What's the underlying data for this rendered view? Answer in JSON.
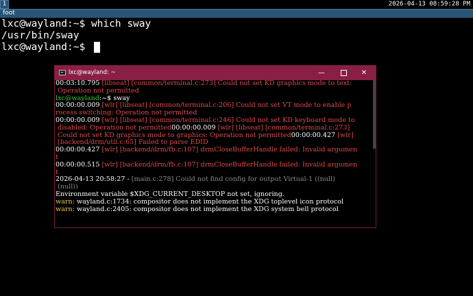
{
  "bar": {
    "workspace": "1",
    "clock": "2026-04-13 08:59:28 PM"
  },
  "window": {
    "title": "foot"
  },
  "foot": {
    "lines": [
      "lxc@wayland:~$ which sway",
      "/usr/bin/sway",
      "lxc@wayland:~$ "
    ]
  },
  "console": {
    "title": "lxc@wayland: ~",
    "buttons": {
      "minimize": "—",
      "close": "✕"
    },
    "lines": [
      {
        "parts": [
          {
            "c": "white",
            "t": "00:03:10.795 "
          },
          {
            "c": "red",
            "t": "[libseat] [common/terminal.c:273] Could not set KD graphics mode to text:"
          }
        ]
      },
      {
        "parts": [
          {
            "c": "red",
            "t": " Operation not permitted"
          }
        ]
      },
      {
        "parts": [
          {
            "c": "grn",
            "t": "lxc@wayland"
          },
          {
            "c": "white",
            "t": ":~$ sway"
          }
        ]
      },
      {
        "parts": [
          {
            "c": "white",
            "t": "00:00:00.009 "
          },
          {
            "c": "red",
            "t": "[wlr] [libseat] [common/terminal.c:206] Could not set VT mode to enable p"
          }
        ]
      },
      {
        "parts": [
          {
            "c": "red",
            "t": "rocess switching: Operation not permitted"
          }
        ]
      },
      {
        "parts": [
          {
            "c": "white",
            "t": "00:00:00.009 "
          },
          {
            "c": "red",
            "t": "[wlr] [libseat] [common/terminal.c:246] Could not set KD keyboard mode to"
          }
        ]
      },
      {
        "parts": [
          {
            "c": "red",
            "t": " disabled: Operation not permitted"
          },
          {
            "c": "white",
            "t": "00:00:00.009 "
          },
          {
            "c": "red",
            "t": "[wlr] [libseat] [common/terminal.c:273]"
          }
        ]
      },
      {
        "parts": [
          {
            "c": "red",
            "t": " Could not set KD graphics mode to graphics: Operation not permitted"
          },
          {
            "c": "white",
            "t": "00:00:00.427 "
          },
          {
            "c": "red",
            "t": "[wlr]"
          }
        ]
      },
      {
        "parts": [
          {
            "c": "red",
            "t": " [backend/drm/util.c:65] Failed to parse EDID"
          }
        ]
      },
      {
        "parts": [
          {
            "c": "white",
            "t": "00:00:00.427 "
          },
          {
            "c": "red",
            "t": "[wlr] [backend/drm/fb.c:107] drmCloseBufferHandle failed: Invalid argumen"
          }
        ]
      },
      {
        "parts": [
          {
            "c": "red",
            "t": "t"
          }
        ]
      },
      {
        "parts": [
          {
            "c": "white",
            "t": "00:00:00.515 "
          },
          {
            "c": "red",
            "t": "[wlr] [backend/drm/fb.c:107] drmCloseBufferHandle failed: Invalid argumen"
          }
        ]
      },
      {
        "parts": [
          {
            "c": "red",
            "t": "t"
          }
        ]
      },
      {
        "parts": [
          {
            "c": "white",
            "t": "2026-04-13 20:58:27 - "
          },
          {
            "c": "gry",
            "t": "[main.c:278] Could not find config for output Virtual-1 ((null)"
          }
        ]
      },
      {
        "parts": [
          {
            "c": "gry",
            "t": " (null))"
          }
        ]
      },
      {
        "parts": [
          {
            "c": "white",
            "t": "Environment variable $XDG_CURRENT_DESKTOP not set, ignoring."
          }
        ]
      },
      {
        "parts": [
          {
            "c": "yel",
            "t": "warn: "
          },
          {
            "c": "white",
            "t": "wayland.c:1734: compositor does not implement the XDG toplevel icon protocol"
          }
        ]
      },
      {
        "parts": [
          {
            "c": "yel",
            "t": "warn: "
          },
          {
            "c": "white",
            "t": "wayland.c:2405: compositor does not implement the XDG system bell protocol"
          }
        ]
      }
    ]
  },
  "colors": {
    "red": "#e04a4a",
    "green": "#39c93a",
    "yellow": "#e6c84c",
    "gray": "#8a8a8a",
    "titlebar": "#8a1f45"
  }
}
